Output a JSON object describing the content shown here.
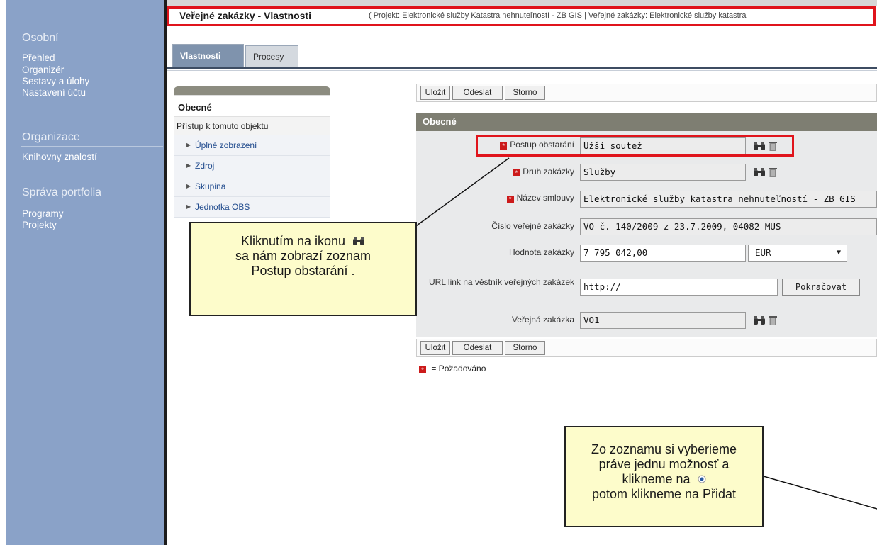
{
  "sidebar": {
    "sections": [
      {
        "title": "Osobní",
        "items": [
          "Přehled",
          "Organizér",
          "Sestavy a úlohy",
          "Nastavení účtu"
        ]
      },
      {
        "title": "Organizace",
        "items": [
          "Knihovny znalostí"
        ]
      },
      {
        "title": "Správa portfolia",
        "items": [
          "Programy",
          "Projekty"
        ]
      }
    ]
  },
  "header": {
    "title": "Veřejné zakázky - Vlastnosti",
    "path": "( Projekt: Elektronické služby Katastra nehnuteľností - ZB GIS | Veřejné zakázky: Elektronické služby katastra"
  },
  "tabs": [
    "Vlastnosti",
    "Procesy"
  ],
  "nav": {
    "active": "Obecné",
    "access": "Přístup k tomuto objektu",
    "items": [
      "Úplné zobrazení",
      "Zdroj",
      "Skupina",
      "Jednotka OBS"
    ]
  },
  "buttons": {
    "save": "Uložit",
    "send": "Odeslat",
    "cancel": "Storno"
  },
  "form": {
    "section_title": "Obecné",
    "fields": {
      "postup": {
        "label": "Postup obstarání",
        "value": "Užší soutež"
      },
      "druh": {
        "label": "Druh zakázky",
        "value": "Služby"
      },
      "nazev": {
        "label": "Název smlouvy",
        "value": "Elektronické služby katastra nehnuteľností - ZB GIS"
      },
      "cislo": {
        "label": "Číslo veřejné zakázky",
        "value": "VO č. 140/2009 z 23.7.2009, 04082-MUS"
      },
      "hodnota": {
        "label": "Hodnota zakázky",
        "value": "7 795 042,00",
        "currency": "EUR"
      },
      "url": {
        "label": "URL link na věstník veřejných zakázek",
        "value": "http://",
        "button": "Pokračovat"
      },
      "verejna": {
        "label": "Veřejná zakázka",
        "value": "VO1"
      }
    },
    "legend": "= Požadováno"
  },
  "callouts": {
    "first": {
      "line1": "Kliknutím na ikonu",
      "line2": "sa nám zobrazí zoznam",
      "line3": "Postup obstarání ."
    },
    "second": {
      "line1": "Zo zoznamu si vyberieme",
      "line2": "práve jednu možnosť a",
      "line3": "klikneme na",
      "line4": "potom klikneme na Přidat"
    }
  },
  "colors": {
    "sidebar": "#8aa2c8",
    "accent_red": "#e0141c",
    "form_header": "#7e7e72",
    "callout_bg": "#fdfccb"
  },
  "icons": {
    "lookup": "binoculars-icon",
    "clear": "trash-icon",
    "required": "required-marker-icon",
    "radio": "radio-button-icon"
  }
}
